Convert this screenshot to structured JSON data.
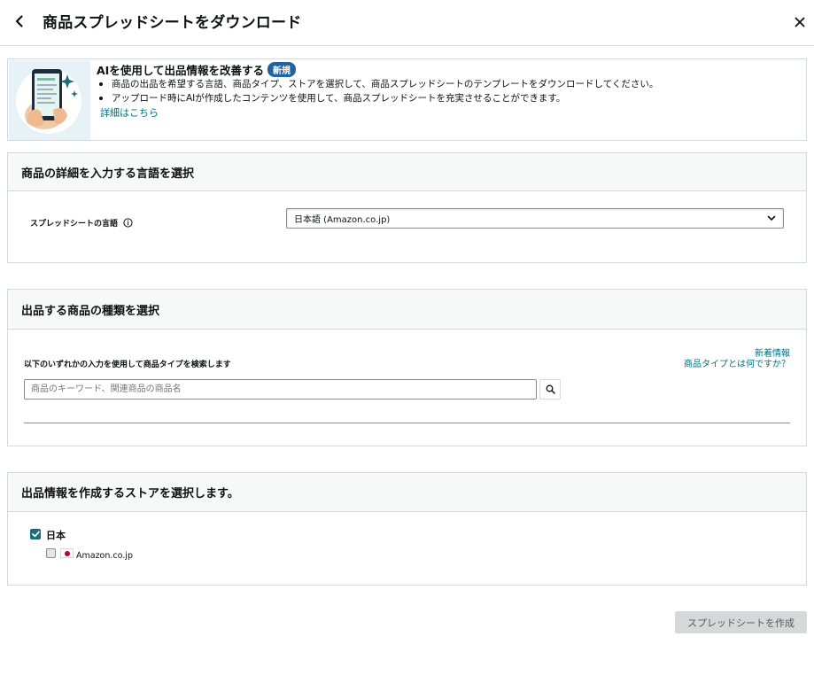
{
  "header": {
    "title": "商品スプレッドシートをダウンロード",
    "back_icon": "chevron-left-icon",
    "close_icon": "close-icon"
  },
  "banner": {
    "title": "AIを使用して出品情報を改善する",
    "badge": "新規",
    "bullets": [
      "商品の出品を希望する言語、商品タイプ、ストアを選択して、商品スプレッドシートのテンプレートをダウンロードしてください。",
      "アップロード時にAIが作成したコンテンツを使用して、商品スプレッドシートを充実させることができます。"
    ],
    "link": "詳細はこちら",
    "illustration": "phone-with-sparkles-illustration"
  },
  "language_section": {
    "title": "商品の詳細を入力する言語を選択",
    "field_label": "スプレッドシートの言語",
    "info_icon": "info-icon",
    "selected_value": "日本語 (Amazon.co.jp)",
    "dropdown_icon": "chevron-down-icon"
  },
  "product_type_section": {
    "title": "出品する商品の種類を選択",
    "search_label": "以下のいずれかの入力を使用して商品タイプを検索します",
    "link_new": "新着情報",
    "link_help": "商品タイプとは何ですか？",
    "search_placeholder": "商品のキーワード、関連商品の商品名",
    "search_icon": "search-icon"
  },
  "store_section": {
    "title": "出品情報を作成するストアを選択します。",
    "region_label": "日本",
    "region_checked": true,
    "store_label": "Amazon.co.jp",
    "store_checked": false,
    "flag_icon": "japan-flag-icon"
  },
  "footer": {
    "create_button": "スプレッドシートを作成"
  },
  "colors": {
    "link": "#007185",
    "badge": "#2162a1",
    "checkbox": "#1b6b7a",
    "disabled_button": "#d5d9d9"
  }
}
